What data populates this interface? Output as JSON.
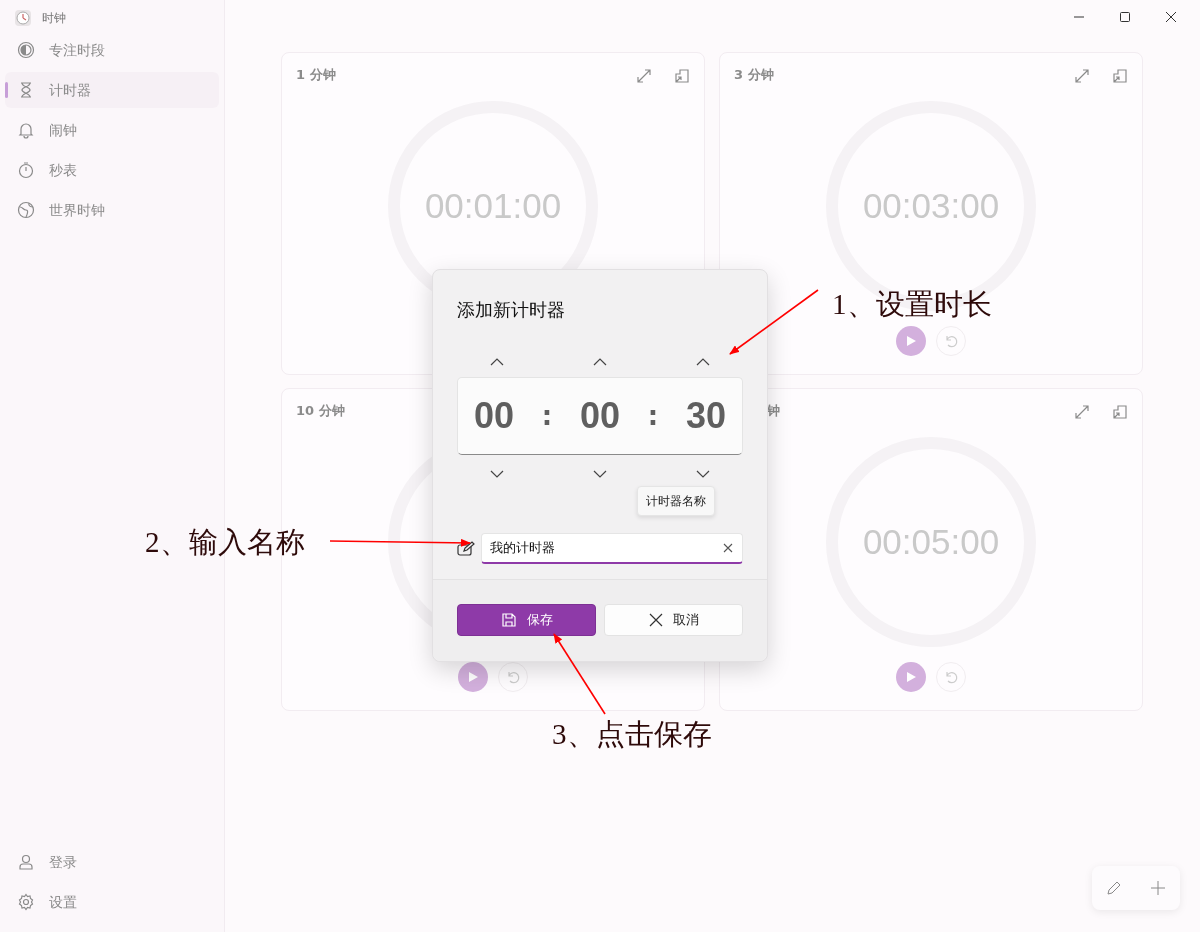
{
  "window": {
    "title": "时钟"
  },
  "sidebar": {
    "items": [
      {
        "label": "专注时段",
        "selected": false
      },
      {
        "label": "计时器",
        "selected": true
      },
      {
        "label": "闹钟",
        "selected": false
      },
      {
        "label": "秒表",
        "selected": false
      },
      {
        "label": "世界时钟",
        "selected": false
      }
    ],
    "footer_items": [
      {
        "label": "登录"
      },
      {
        "label": "设置"
      }
    ]
  },
  "cards": [
    {
      "title": "1 分钟",
      "title_cut": false,
      "tools_visible": true,
      "time": "00:01:00",
      "controls_visible": false
    },
    {
      "title": "3 分钟",
      "title_cut": false,
      "tools_visible": true,
      "time": "00:03:00",
      "controls_visible": true
    },
    {
      "title": "10 分钟",
      "title_cut": false,
      "tools_visible": false,
      "controls_visible": true
    },
    {
      "title": "钟",
      "title_cut": true,
      "tools_visible": true,
      "time": "00:05:00",
      "controls_visible": true
    }
  ],
  "dialog": {
    "title": "添加新计时器",
    "hours": "00",
    "minutes": "00",
    "seconds": "30",
    "separators": [
      ":",
      ":"
    ],
    "tooltip": "计时器名称",
    "name_field": {
      "value": "我的计时器"
    },
    "buttons": [
      {
        "label": "保存",
        "kind": "primary"
      },
      {
        "label": "取消",
        "kind": "secondary"
      }
    ]
  },
  "annotations": [
    {
      "text": "1、设置时长"
    },
    {
      "text": "2、输入名称"
    },
    {
      "text": "3、点击保存"
    }
  ]
}
